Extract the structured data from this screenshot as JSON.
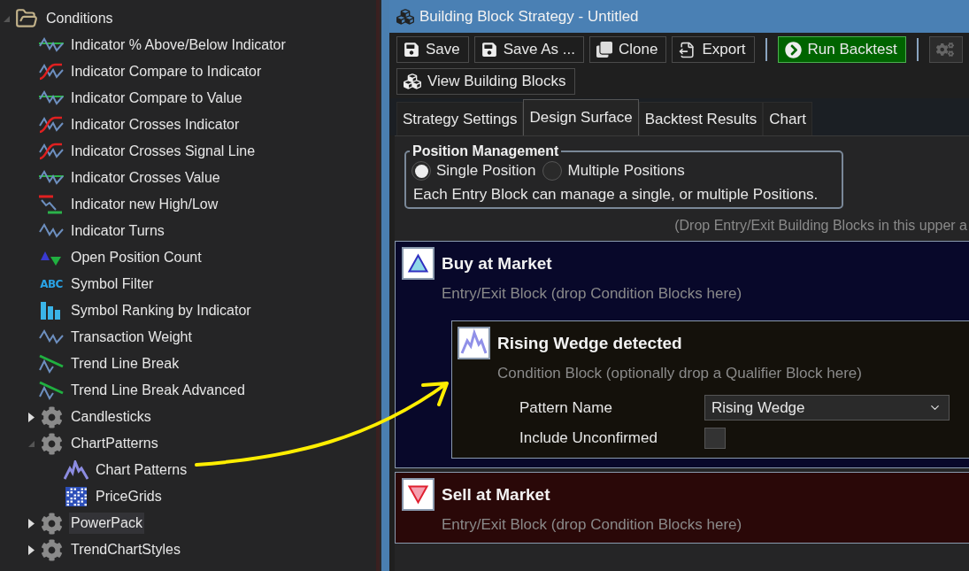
{
  "tree": [
    {
      "label": "Conditions",
      "kind": "folder",
      "expanded": true,
      "selected": false,
      "children": [
        {
          "label": "Indicator % Above/Below Indicator",
          "kind": "band",
          "selected": false
        },
        {
          "label": "Indicator Compare to Indicator",
          "kind": "cross",
          "selected": false
        },
        {
          "label": "Indicator Compare to Value",
          "kind": "band",
          "selected": false
        },
        {
          "label": "Indicator Crosses Indicator",
          "kind": "cross",
          "selected": false
        },
        {
          "label": "Indicator Crosses Signal Line",
          "kind": "cross",
          "selected": false
        },
        {
          "label": "Indicator Crosses Value",
          "kind": "band",
          "selected": false
        },
        {
          "label": "Indicator new High/Low",
          "kind": "highlow",
          "selected": false
        },
        {
          "label": "Indicator Turns",
          "kind": "wave",
          "selected": false
        },
        {
          "label": "Open Position Count",
          "kind": "count",
          "selected": false
        },
        {
          "label": "Symbol Filter",
          "kind": "text",
          "icon_text": "ABC",
          "selected": false
        },
        {
          "label": "Symbol Ranking by Indicator",
          "kind": "bars",
          "selected": false
        },
        {
          "label": "Transaction Weight",
          "kind": "wave",
          "selected": false
        },
        {
          "label": "Trend Line Break",
          "kind": "trendline",
          "selected": false
        },
        {
          "label": "Trend Line Break Advanced",
          "kind": "trendline",
          "selected": false
        },
        {
          "label": "Candlesticks",
          "kind": "gear",
          "expanded": false,
          "selected": false
        },
        {
          "label": "ChartPatterns",
          "kind": "gear",
          "expanded": true,
          "selected": false,
          "children": [
            {
              "label": "Chart Patterns",
              "kind": "peaks",
              "selected": false
            },
            {
              "label": "PriceGrids",
              "kind": "grid",
              "selected": false
            }
          ]
        },
        {
          "label": "PowerPack",
          "kind": "gear",
          "expanded": false,
          "selected": true
        },
        {
          "label": "TrendChartStyles",
          "kind": "gear",
          "expanded": false,
          "selected": false
        }
      ]
    }
  ],
  "window": {
    "title": "Building Block Strategy - Untitled"
  },
  "toolbar": [
    {
      "label": "Save",
      "kind": "save"
    },
    {
      "label": "Save As ...",
      "kind": "save"
    },
    {
      "label": "Clone",
      "kind": "clone"
    },
    {
      "label": "Export",
      "kind": "export"
    },
    {
      "kind": "separator"
    },
    {
      "label": "Run Backtest",
      "kind": "run"
    },
    {
      "kind": "separator"
    },
    {
      "kind": "gears",
      "disabled": true
    }
  ],
  "view_button": {
    "label": "View Building Blocks"
  },
  "tabs": [
    {
      "label": "Strategy Settings",
      "selected": false
    },
    {
      "label": "Design Surface",
      "selected": true
    },
    {
      "label": "Backtest Results",
      "selected": false
    },
    {
      "label": "Chart",
      "selected": false
    }
  ],
  "position_management": {
    "title": "Position Management",
    "options": [
      {
        "label": "Single Position",
        "selected": true
      },
      {
        "label": "Multiple Positions",
        "selected": false
      }
    ],
    "note": "Each Entry Block can manage a single, or multiple Positions."
  },
  "drop_hint": "(Drop Entry/Exit Building Blocks in this upper a",
  "blocks": [
    {
      "kind": "buy",
      "title": "Buy at Market",
      "subtitle": "Entry/Exit Block (drop Condition Blocks here)",
      "conditions": [
        {
          "title": "Rising Wedge detected",
          "subtitle": "Condition Block (optionally drop a Qualifier Block here)",
          "params": [
            {
              "kind": "dropdown",
              "label": "Pattern Name",
              "value": "Rising Wedge"
            },
            {
              "kind": "checkbox",
              "label": "Include Unconfirmed",
              "checked": false
            }
          ]
        }
      ]
    },
    {
      "kind": "sell",
      "title": "Sell at Market",
      "subtitle": "Entry/Exit Block (drop Condition Blocks here)"
    }
  ]
}
